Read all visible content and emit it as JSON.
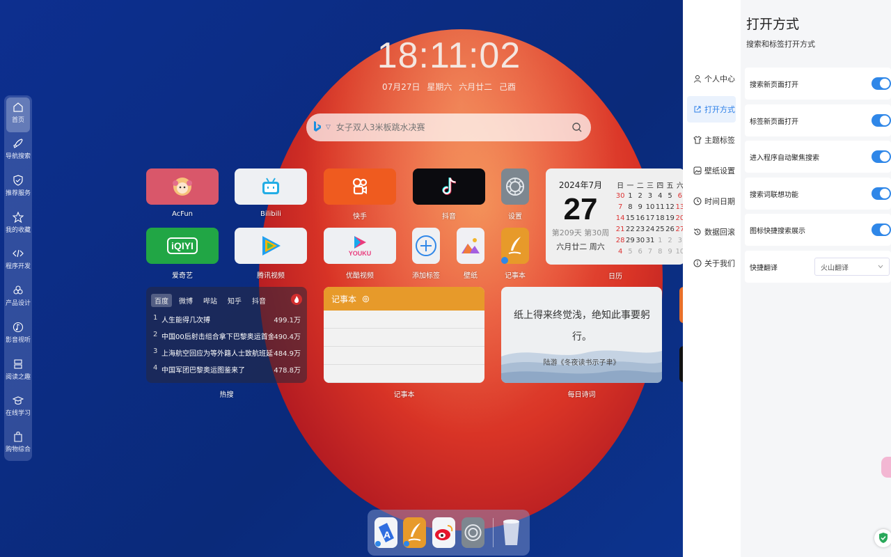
{
  "clock": {
    "time": "18:11:02",
    "date": "07月27日",
    "weekday": "星期六",
    "lunar": "六月廿二",
    "year": "己酉"
  },
  "search": {
    "placeholder": "女子双人3米板跳水决赛",
    "engine_icon": "bing-icon"
  },
  "sidebar": {
    "items": [
      {
        "label": "首页",
        "icon": "home-icon"
      },
      {
        "label": "导航搜索",
        "icon": "rocket-icon"
      },
      {
        "label": "推荐服务",
        "icon": "shield-check-icon"
      },
      {
        "label": "我的收藏",
        "icon": "star-icon"
      },
      {
        "label": "程序开发",
        "icon": "code-icon"
      },
      {
        "label": "产品设计",
        "icon": "flower-icon"
      },
      {
        "label": "影音视听",
        "icon": "music-icon"
      },
      {
        "label": "阅读之趣",
        "icon": "book-icon"
      },
      {
        "label": "在线学习",
        "icon": "graduation-cap-icon"
      },
      {
        "label": "购物综合",
        "icon": "shopping-bag-icon"
      }
    ]
  },
  "apps": {
    "acfun": "AcFun",
    "bilibili": "Bilibili",
    "kuaishou": "快手",
    "douyin": "抖音",
    "settings": "设置",
    "iqiyi": "爱奇艺",
    "tencent": "腾讯视频",
    "youku": "优酷视频",
    "add_tag": "添加标签",
    "wallpaper": "壁纸",
    "notepad": "记事本",
    "calendar": "日历"
  },
  "logos": {
    "iqiyi": "iQIYI",
    "youku": "YOUKU"
  },
  "calendar": {
    "month_title": "2024年7月",
    "day": "27",
    "week_info": "第209天 第30周",
    "lunar": "六月廿二 周六",
    "headers": [
      "日",
      "一",
      "二",
      "三",
      "四",
      "五",
      "六"
    ],
    "rows": [
      [
        "30",
        "1",
        "2",
        "3",
        "4",
        "5",
        "6"
      ],
      [
        "7",
        "8",
        "9",
        "10",
        "11",
        "12",
        "13"
      ],
      [
        "14",
        "15",
        "16",
        "17",
        "18",
        "19",
        "20"
      ],
      [
        "21",
        "22",
        "23",
        "24",
        "25",
        "26",
        "27"
      ],
      [
        "28",
        "29",
        "30",
        "31",
        "1",
        "2",
        "3"
      ],
      [
        "4",
        "5",
        "6",
        "7",
        "8",
        "9",
        "10"
      ]
    ]
  },
  "hot": {
    "tabs": [
      "百度",
      "微博",
      "哔站",
      "知乎",
      "抖音"
    ],
    "items": [
      {
        "n": "1",
        "title": "人生能得几次搏",
        "value": "499.1万"
      },
      {
        "n": "2",
        "title": "中国00后射击组合拿下巴黎奥运首金",
        "value": "490.4万"
      },
      {
        "n": "3",
        "title": "上海航空回应为等外籍人士致航班延误",
        "value": "484.9万"
      },
      {
        "n": "4",
        "title": "中国军团巴黎奥运图鉴来了",
        "value": "478.8万"
      }
    ],
    "label": "热搜"
  },
  "notepad": {
    "title": "记事本",
    "label": "记事本"
  },
  "poem": {
    "line1": "纸上得来终觉浅，绝知此事要躬",
    "line2": "行。",
    "source": "陆游《冬夜读书示子聿》",
    "label": "每日诗词"
  },
  "panel": {
    "title": "打开方式",
    "subtitle": "搜索和标签打开方式",
    "nav": [
      {
        "label": "个人中心",
        "icon": "user-icon"
      },
      {
        "label": "打开方式",
        "icon": "external-link-icon"
      },
      {
        "label": "主题标签",
        "icon": "shirt-icon"
      },
      {
        "label": "壁纸设置",
        "icon": "image-icon"
      },
      {
        "label": "时间日期",
        "icon": "clock-icon"
      },
      {
        "label": "数据回滚",
        "icon": "history-icon"
      },
      {
        "label": "关于我们",
        "icon": "info-icon"
      }
    ],
    "settings": [
      {
        "label": "搜索新页面打开",
        "on": true
      },
      {
        "label": "标签新页面打开",
        "on": true
      },
      {
        "label": "进入程序自动聚焦搜索",
        "on": true
      },
      {
        "label": "搜索词联想功能",
        "on": true
      },
      {
        "label": "图标快捷搜索展示",
        "on": true
      }
    ],
    "translate": {
      "label": "快捷翻译",
      "value": "火山翻译"
    }
  },
  "colors": {
    "accent": "#2f87e8",
    "acfun": "#d9576a",
    "iqiyi": "#21a645",
    "kuaishou": "#ef5b1f",
    "notepad": "#e79a2a"
  }
}
